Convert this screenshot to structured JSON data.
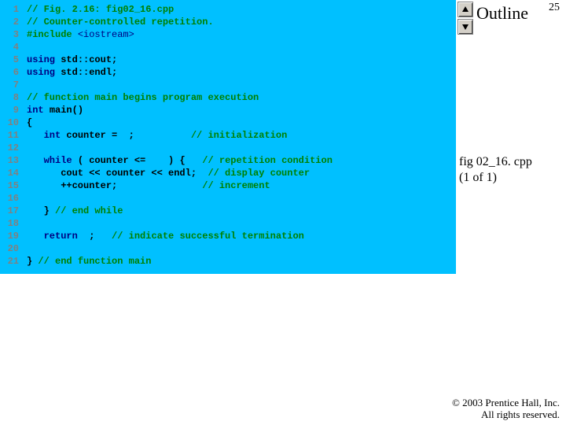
{
  "header": {
    "outline_label": "Outline",
    "page_number": "25",
    "nav_up_icon": "up-arrow",
    "nav_down_icon": "down-arrow"
  },
  "figure_ref": {
    "name": "fig 02_16. cpp",
    "part": "(1 of 1)"
  },
  "copyright": {
    "line1": "© 2003 Prentice Hall, Inc.",
    "line2": "All rights reserved."
  },
  "code": {
    "lines": [
      {
        "n": "1",
        "segs": [
          {
            "cls": "c-comment",
            "t": "// Fig. 2.16: fig02_16.cpp"
          }
        ]
      },
      {
        "n": "2",
        "segs": [
          {
            "cls": "c-comment",
            "t": "// Counter-controlled repetition."
          }
        ]
      },
      {
        "n": "3",
        "segs": [
          {
            "cls": "c-pre",
            "t": "#include "
          },
          {
            "cls": "c-dim",
            "t": "<iostream>"
          }
        ]
      },
      {
        "n": "4",
        "segs": [
          {
            "cls": "c-plain",
            "t": ""
          }
        ]
      },
      {
        "n": "5",
        "segs": [
          {
            "cls": "c-kw",
            "t": "using "
          },
          {
            "cls": "c-plain",
            "t": "std::cout;"
          }
        ]
      },
      {
        "n": "6",
        "segs": [
          {
            "cls": "c-kw",
            "t": "using "
          },
          {
            "cls": "c-plain",
            "t": "std::endl;"
          }
        ]
      },
      {
        "n": "7",
        "segs": [
          {
            "cls": "c-plain",
            "t": ""
          }
        ]
      },
      {
        "n": "8",
        "segs": [
          {
            "cls": "c-comment",
            "t": "// function main begins program execution"
          }
        ]
      },
      {
        "n": "9",
        "segs": [
          {
            "cls": "c-kw",
            "t": "int "
          },
          {
            "cls": "c-plain",
            "t": "main()"
          }
        ]
      },
      {
        "n": "10",
        "segs": [
          {
            "cls": "c-plain",
            "t": "{"
          }
        ]
      },
      {
        "n": "11",
        "segs": [
          {
            "cls": "c-plain",
            "t": "   "
          },
          {
            "cls": "c-kw",
            "t": "int "
          },
          {
            "cls": "c-plain",
            "t": "counter =  ;          "
          },
          {
            "cls": "c-comment",
            "t": "// initialization"
          }
        ]
      },
      {
        "n": "12",
        "segs": [
          {
            "cls": "c-plain",
            "t": ""
          }
        ]
      },
      {
        "n": "13",
        "segs": [
          {
            "cls": "c-plain",
            "t": "   "
          },
          {
            "cls": "c-kw",
            "t": "while "
          },
          {
            "cls": "c-plain",
            "t": "( counter <=    ) {   "
          },
          {
            "cls": "c-comment",
            "t": "// repetition condition"
          }
        ]
      },
      {
        "n": "14",
        "segs": [
          {
            "cls": "c-plain",
            "t": "      cout << counter << endl;  "
          },
          {
            "cls": "c-comment",
            "t": "// display counter"
          }
        ]
      },
      {
        "n": "15",
        "segs": [
          {
            "cls": "c-plain",
            "t": "      ++counter;               "
          },
          {
            "cls": "c-comment",
            "t": "// increment"
          }
        ]
      },
      {
        "n": "16",
        "segs": [
          {
            "cls": "c-plain",
            "t": ""
          }
        ]
      },
      {
        "n": "17",
        "segs": [
          {
            "cls": "c-plain",
            "t": "   } "
          },
          {
            "cls": "c-comment",
            "t": "// end while"
          }
        ]
      },
      {
        "n": "18",
        "segs": [
          {
            "cls": "c-plain",
            "t": ""
          }
        ]
      },
      {
        "n": "19",
        "segs": [
          {
            "cls": "c-plain",
            "t": "   "
          },
          {
            "cls": "c-kw",
            "t": "return  "
          },
          {
            "cls": "c-plain",
            "t": ";   "
          },
          {
            "cls": "c-comment",
            "t": "// indicate successful termination"
          }
        ]
      },
      {
        "n": "20",
        "segs": [
          {
            "cls": "c-plain",
            "t": ""
          }
        ]
      },
      {
        "n": "21",
        "segs": [
          {
            "cls": "c-plain",
            "t": "} "
          },
          {
            "cls": "c-comment",
            "t": "// end function main"
          }
        ]
      }
    ]
  }
}
